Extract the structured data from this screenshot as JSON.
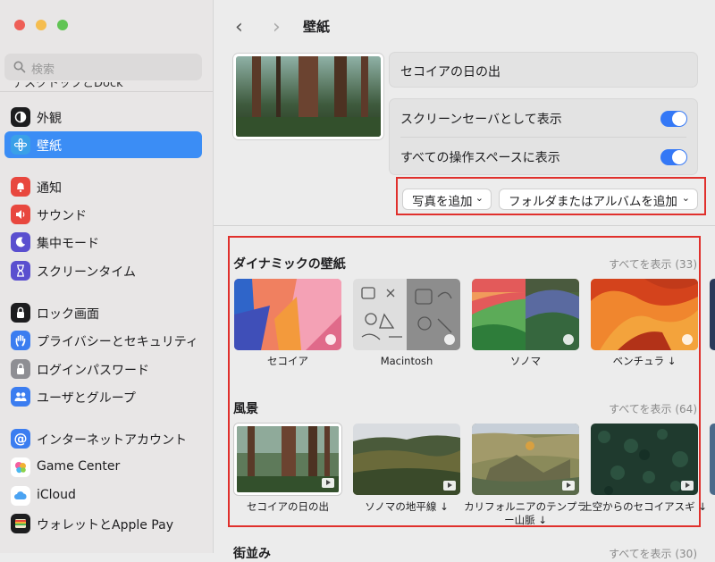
{
  "sidebar": {
    "search_placeholder": "検索",
    "cutoff_item": "デスクトップとDock",
    "items": [
      {
        "label": "外観",
        "icon": "appearance-icon",
        "color": "#1d1d1f"
      },
      {
        "label": "壁紙",
        "icon": "wallpaper-icon",
        "color": "#3aa0e8",
        "selected": true
      },
      {
        "label": "通知",
        "icon": "bell-icon",
        "color": "#e8473e"
      },
      {
        "label": "サウンド",
        "icon": "speaker-icon",
        "color": "#e8473e"
      },
      {
        "label": "集中モード",
        "icon": "moon-icon",
        "color": "#5a4fcf"
      },
      {
        "label": "スクリーンタイム",
        "icon": "hourglass-icon",
        "color": "#5a4fcf"
      },
      {
        "label": "ロック画面",
        "icon": "lock-screen-icon",
        "color": "#1d1d1f"
      },
      {
        "label": "プライバシーとセキュリティ",
        "icon": "hand-icon",
        "color": "#3b7df0"
      },
      {
        "label": "ログインパスワード",
        "icon": "lock-icon",
        "color": "#8e8e93"
      },
      {
        "label": "ユーザとグループ",
        "icon": "users-icon",
        "color": "#3b7df0"
      },
      {
        "label": "インターネットアカウント",
        "icon": "at-icon",
        "color": "#3b7df0"
      },
      {
        "label": "Game Center",
        "icon": "game-center-icon",
        "color": "#ffffff"
      },
      {
        "label": "iCloud",
        "icon": "icloud-icon",
        "color": "#ffffff"
      },
      {
        "label": "ウォレットとApple Pay",
        "icon": "wallet-icon",
        "color": "#1d1d1f"
      }
    ]
  },
  "header": {
    "title": "壁紙",
    "back": "‹",
    "forward": "›"
  },
  "current": {
    "name": "セコイアの日の出",
    "screensaver_label": "スクリーンセーバとして表示",
    "screensaver_on": true,
    "all_spaces_label": "すべての操作スペースに表示",
    "all_spaces_on": true,
    "add_photo": "写真を追加",
    "add_folder": "フォルダまたはアルバムを追加"
  },
  "sections": {
    "dynamic": {
      "title": "ダイナミックの壁紙",
      "more": "すべてを表示 (33)",
      "items": [
        "セコイア",
        "Macintosh",
        "ソノマ",
        "ベンチュラ ↓"
      ]
    },
    "landscape": {
      "title": "風景",
      "more": "すべてを表示 (64)",
      "items": [
        "セコイアの日の出",
        "ソノマの地平線 ↓",
        "カリフォルニアのテンプラー山脈 ↓",
        "上空からのセコイアスギ ↓"
      ]
    },
    "cityscape": {
      "title": "街並み",
      "more": "すべてを表示 (30)"
    }
  },
  "colors": {
    "accent": "#3478f6",
    "highlight": "#e0302c",
    "selection": "#3b8df5"
  }
}
